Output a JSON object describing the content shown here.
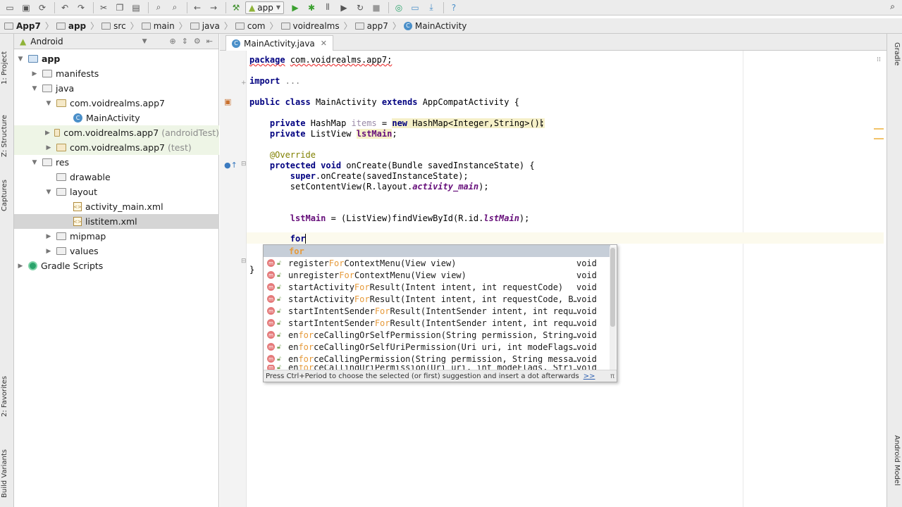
{
  "toolbar": {
    "run_config": "app"
  },
  "breadcrumb": [
    "App7",
    "app",
    "src",
    "main",
    "java",
    "com",
    "voidrealms",
    "app7",
    "MainActivity"
  ],
  "left_tabs": {
    "project": "1: Project",
    "structure": "Z: Structure",
    "captures": "Captures",
    "favorites": "2: Favorites",
    "build_variants": "Build Variants"
  },
  "right_tabs": {
    "gradle": "Gradle",
    "android_model": "Android Model"
  },
  "project_panel": {
    "view_mode": "Android",
    "tree": [
      {
        "label": "app",
        "suffix": ""
      },
      {
        "label": "manifests",
        "suffix": ""
      },
      {
        "label": "java",
        "suffix": ""
      },
      {
        "label": "com.voidrealms.app7",
        "suffix": ""
      },
      {
        "label": "MainActivity",
        "suffix": ""
      },
      {
        "label": "com.voidrealms.app7",
        "suffix": "(androidTest)"
      },
      {
        "label": "com.voidrealms.app7",
        "suffix": "(test)"
      },
      {
        "label": "res",
        "suffix": ""
      },
      {
        "label": "drawable",
        "suffix": ""
      },
      {
        "label": "layout",
        "suffix": ""
      },
      {
        "label": "activity_main.xml",
        "suffix": ""
      },
      {
        "label": "listitem.xml",
        "suffix": ""
      },
      {
        "label": "mipmap",
        "suffix": ""
      },
      {
        "label": "values",
        "suffix": ""
      },
      {
        "label": "Gradle Scripts",
        "suffix": ""
      }
    ]
  },
  "editor": {
    "tab_label": "MainActivity.java",
    "lines": {
      "package_kw": "package",
      "package_name": "com.voidrealms.app7;",
      "import_kw": "import",
      "import_rest": "...",
      "class_decl_kw1": "public class",
      "class_name": "MainActivity",
      "class_decl_kw2": "extends",
      "class_parent": "AppCompatActivity {",
      "field1_kw": "private",
      "field1_type": "HashMap",
      "field1_name": "items",
      "field1_assign": "=",
      "field1_new": "new",
      "field1_rest": "HashMap<Integer,String>();",
      "field2_kw": "private",
      "field2_type": "ListView",
      "field2_name": "lstMain",
      "field2_end": ";",
      "annotation": "@Override",
      "method_kw": "protected void",
      "method_sig": "onCreate(Bundle savedInstanceState) {",
      "super_kw": "super",
      "super_rest": ".onCreate(savedInstanceState);",
      "setcontent_a": "setContentView(R.layout.",
      "setcontent_b": "activity_main",
      "setcontent_c": ");",
      "find_a": "lstMain",
      "find_b": " = (ListView)findViewById(R.id.",
      "find_c": "lstMain",
      "find_d": ");",
      "typed": "for",
      "close_brace": "}"
    }
  },
  "completion": {
    "items": [
      {
        "pre": "",
        "match": "for",
        "post": "",
        "ret": "",
        "keyword": true
      },
      {
        "pre": "register",
        "match": "For",
        "post": "ContextMenu(View view)",
        "ret": "void"
      },
      {
        "pre": "unregister",
        "match": "For",
        "post": "ContextMenu(View view)",
        "ret": "void"
      },
      {
        "pre": "startActivity",
        "match": "For",
        "post": "Result(Intent intent, int requestCode)",
        "ret": "void"
      },
      {
        "pre": "startActivity",
        "match": "For",
        "post": "Result(Intent intent, int requestCode, B…",
        "ret": "void"
      },
      {
        "pre": "startIntentSender",
        "match": "For",
        "post": "Result(IntentSender intent, int requ…",
        "ret": "void"
      },
      {
        "pre": "startIntentSender",
        "match": "For",
        "post": "Result(IntentSender intent, int requ…",
        "ret": "void"
      },
      {
        "pre": "en",
        "match": "for",
        "post": "ceCallingOrSelfPermission(String permission, String…",
        "ret": "void"
      },
      {
        "pre": "en",
        "match": "for",
        "post": "ceCallingOrSelfUriPermission(Uri uri, int modeFlags…",
        "ret": "void"
      },
      {
        "pre": "en",
        "match": "for",
        "post": "ceCallingPermission(String permission, String messa…",
        "ret": "void"
      },
      {
        "pre": "en",
        "match": "for",
        "post": "ceCallingUriPermission(Uri uri, int modeFlags, Stri…",
        "ret": "void"
      }
    ],
    "footer": "Press Ctrl+Period to choose the selected (or first) suggestion and insert a dot afterwards",
    "footer_link": ">>",
    "footer_icon": "π"
  },
  "colors": {
    "keyword": "#000080",
    "match": "#e69a3a",
    "selection": "#c6ced8",
    "android_green": "#8fb339"
  }
}
